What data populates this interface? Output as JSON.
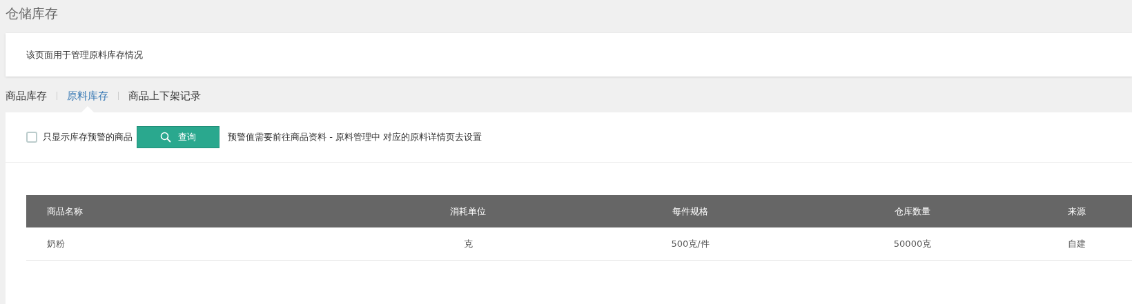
{
  "page_title": "仓储库存",
  "notice": "该页面用于管理原料库存情况",
  "tabs": [
    {
      "label": "商品库存",
      "selected": false
    },
    {
      "label": "原料库存",
      "selected": true
    },
    {
      "label": "商品上下架记录",
      "selected": false
    }
  ],
  "filter": {
    "label": "只显示库存预警的商品",
    "checked": false
  },
  "query_button": "查询",
  "hint": "预警值需要前往商品资料 - 原料管理中 对应的原料详情页去设置",
  "table": {
    "columns": [
      "商品名称",
      "消耗单位",
      "每件规格",
      "仓库数量",
      "来源"
    ],
    "rows": [
      [
        "奶粉",
        "克",
        "500克/件",
        "50000克",
        "自建"
      ]
    ]
  }
}
